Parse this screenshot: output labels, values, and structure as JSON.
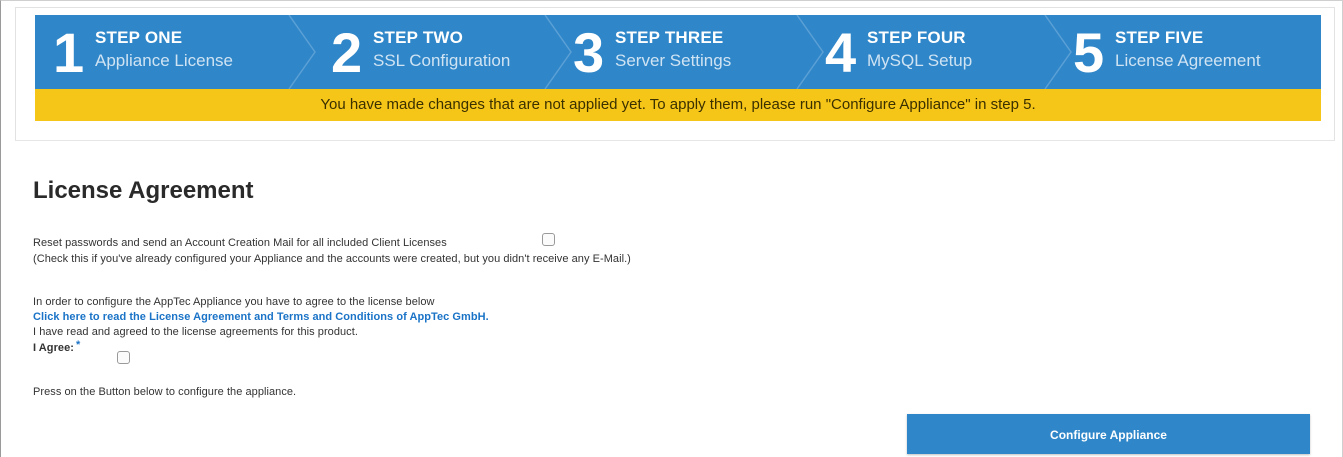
{
  "wizard": {
    "steps": [
      {
        "number": "1",
        "title": "STEP ONE",
        "subtitle": "Appliance License"
      },
      {
        "number": "2",
        "title": "STEP TWO",
        "subtitle": "SSL Configuration"
      },
      {
        "number": "3",
        "title": "STEP THREE",
        "subtitle": "Server Settings"
      },
      {
        "number": "4",
        "title": "STEP FOUR",
        "subtitle": "MySQL Setup"
      },
      {
        "number": "5",
        "title": "STEP FIVE",
        "subtitle": "License Agreement"
      }
    ],
    "banner": "You have made changes that are not applied yet. To apply them, please run \"Configure Appliance\" in step 5."
  },
  "main": {
    "title": "License Agreement",
    "reset_label": "Reset passwords and send an Account Creation Mail for all included Client Licenses",
    "reset_note": "(Check this if you've already configured your Appliance and the accounts were created, but you didn't receive any E-Mail.)",
    "agree_intro": "In order to configure the AppTec Appliance you have to agree to the license below",
    "license_link": "Click here to read the License Agreement and Terms and Conditions of AppTec GmbH.",
    "agree_statement": "I have read and agreed to the license agreements for this product.",
    "agree_label": "I Agree:",
    "required_mark": "*",
    "press_instruction": "Press on the Button below to configure the appliance.",
    "configure_button": "Configure Appliance"
  },
  "colors": {
    "wizard_blue": "#2f86c8",
    "banner_yellow": "#f5c518",
    "link_blue": "#1a73c7"
  }
}
